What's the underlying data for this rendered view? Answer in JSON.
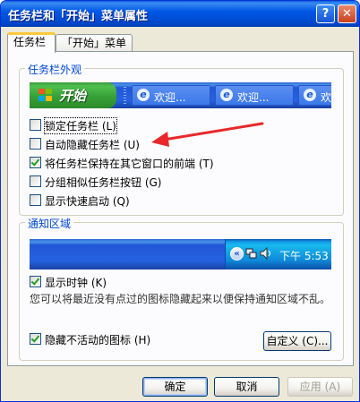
{
  "window": {
    "title": "任务栏和「开始」菜单属性",
    "help_glyph": "?",
    "close_glyph": "✕"
  },
  "tabs": [
    {
      "label": "任务栏"
    },
    {
      "label": "「开始」菜单"
    }
  ],
  "appearance": {
    "group_title": "任务栏外观",
    "start_label": "开始",
    "task_items": [
      {
        "label": "欢迎..."
      },
      {
        "label": "欢迎..."
      },
      {
        "label": "欢"
      }
    ],
    "options": [
      {
        "label": "锁定任务栏 (L)",
        "checked": false
      },
      {
        "label": "自动隐藏任务栏 (U)",
        "checked": false
      },
      {
        "label": "将任务栏保持在其它窗口的前端 (T)",
        "checked": true
      },
      {
        "label": "分组相似任务栏按钮 (G)",
        "checked": false
      },
      {
        "label": "显示快速启动 (Q)",
        "checked": false
      }
    ]
  },
  "notification": {
    "group_title": "通知区域",
    "clock_text": "下午 5:53",
    "show_clock": {
      "label": "显示时钟 (K)",
      "checked": true
    },
    "description": "您可以将最近没有点过的图标隐藏起来以便保持通知区域不乱。",
    "hide_inactive": {
      "label": "隐藏不活动的图标 (H)",
      "checked": true
    },
    "customize_label": "自定义 (C)..."
  },
  "buttons": {
    "ok": "确定",
    "cancel": "取消",
    "apply": "应用 (A)"
  },
  "colors": {
    "title_blue": "#0058e6",
    "group_title": "#0046d5",
    "arrow": "#e8282a",
    "start_green": "#37a137"
  }
}
